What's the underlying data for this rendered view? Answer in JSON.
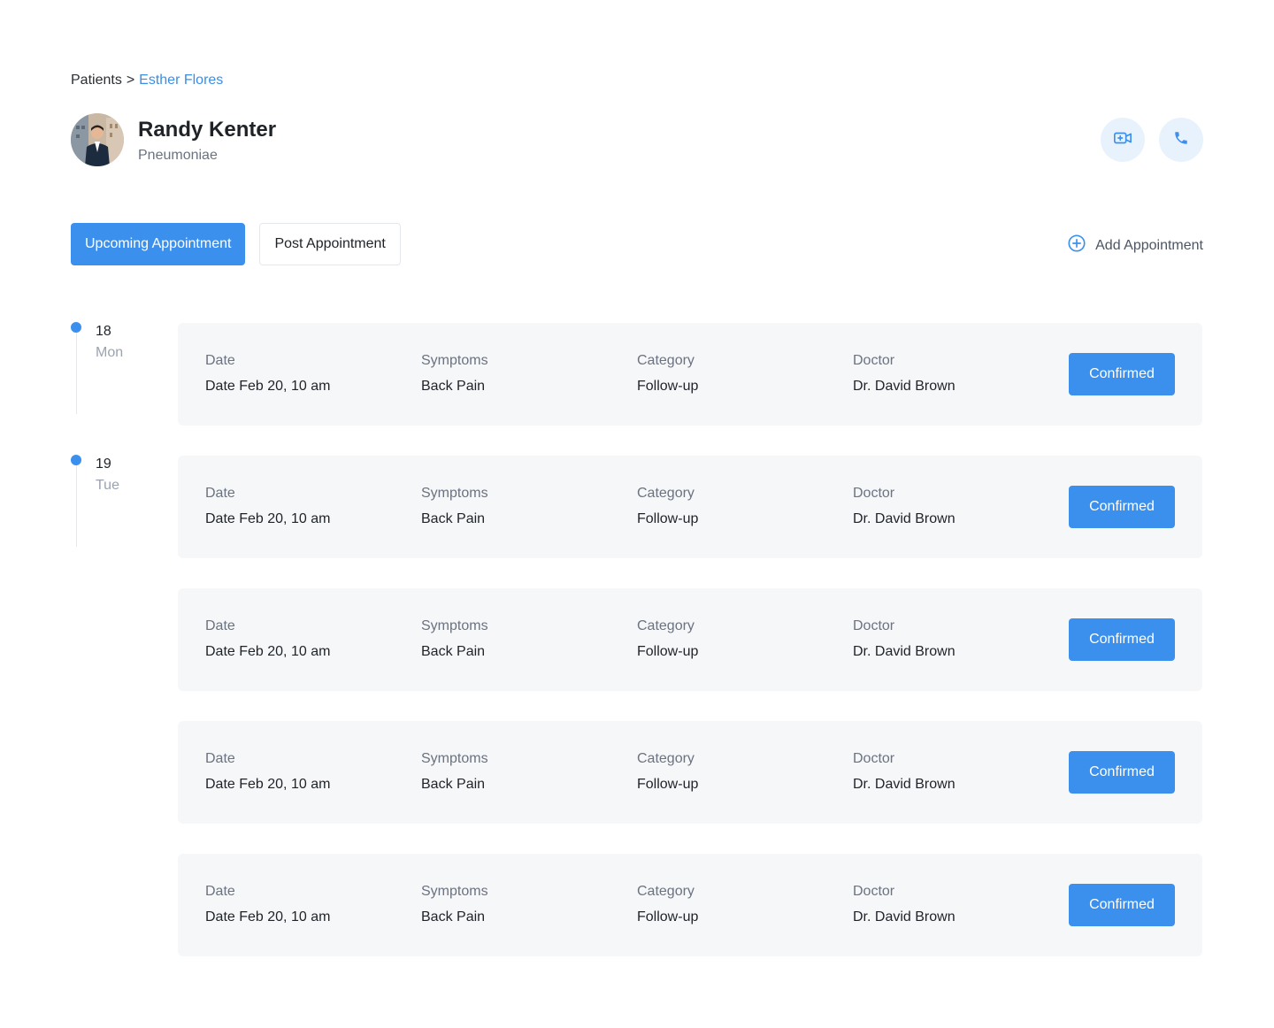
{
  "breadcrumb": {
    "root": "Patients",
    "separator": ">",
    "current": "Esther Flores"
  },
  "patient": {
    "name": "Randy Kenter",
    "condition": "Pneumoniae",
    "avatar_icon": "patient-avatar"
  },
  "actions": {
    "video_icon": "video-call-icon",
    "phone_icon": "phone-icon"
  },
  "tabs": [
    {
      "label": "Upcoming Appointment",
      "active": true
    },
    {
      "label": "Post Appointment",
      "active": false
    }
  ],
  "add_appointment": {
    "label": "Add Appointment",
    "icon": "plus-circle-icon"
  },
  "timeline": [
    {
      "day": "18",
      "dow": "Mon"
    },
    {
      "day": "19",
      "dow": "Tue"
    }
  ],
  "field_labels": {
    "date": "Date",
    "symptoms": "Symptoms",
    "category": "Category",
    "doctor": "Doctor"
  },
  "appointments": [
    {
      "date": "Date Feb 20, 10 am",
      "symptoms": "Back Pain",
      "category": "Follow-up",
      "doctor": "Dr. David Brown",
      "status": "Confirmed"
    },
    {
      "date": "Date Feb 20, 10 am",
      "symptoms": "Back Pain",
      "category": "Follow-up",
      "doctor": "Dr. David Brown",
      "status": "Confirmed"
    },
    {
      "date": "Date Feb 20, 10 am",
      "symptoms": "Back Pain",
      "category": "Follow-up",
      "doctor": "Dr. David Brown",
      "status": "Confirmed"
    },
    {
      "date": "Date Feb 20, 10 am",
      "symptoms": "Back Pain",
      "category": "Follow-up",
      "doctor": "Dr. David Brown",
      "status": "Confirmed"
    },
    {
      "date": "Date Feb 20, 10 am",
      "symptoms": "Back Pain",
      "category": "Follow-up",
      "doctor": "Dr. David Brown",
      "status": "Confirmed"
    }
  ],
  "colors": {
    "accent": "#3b90ee",
    "link": "#3a8ee6",
    "card_bg": "#f6f7f9",
    "icon_bg": "#e8f2fd"
  }
}
